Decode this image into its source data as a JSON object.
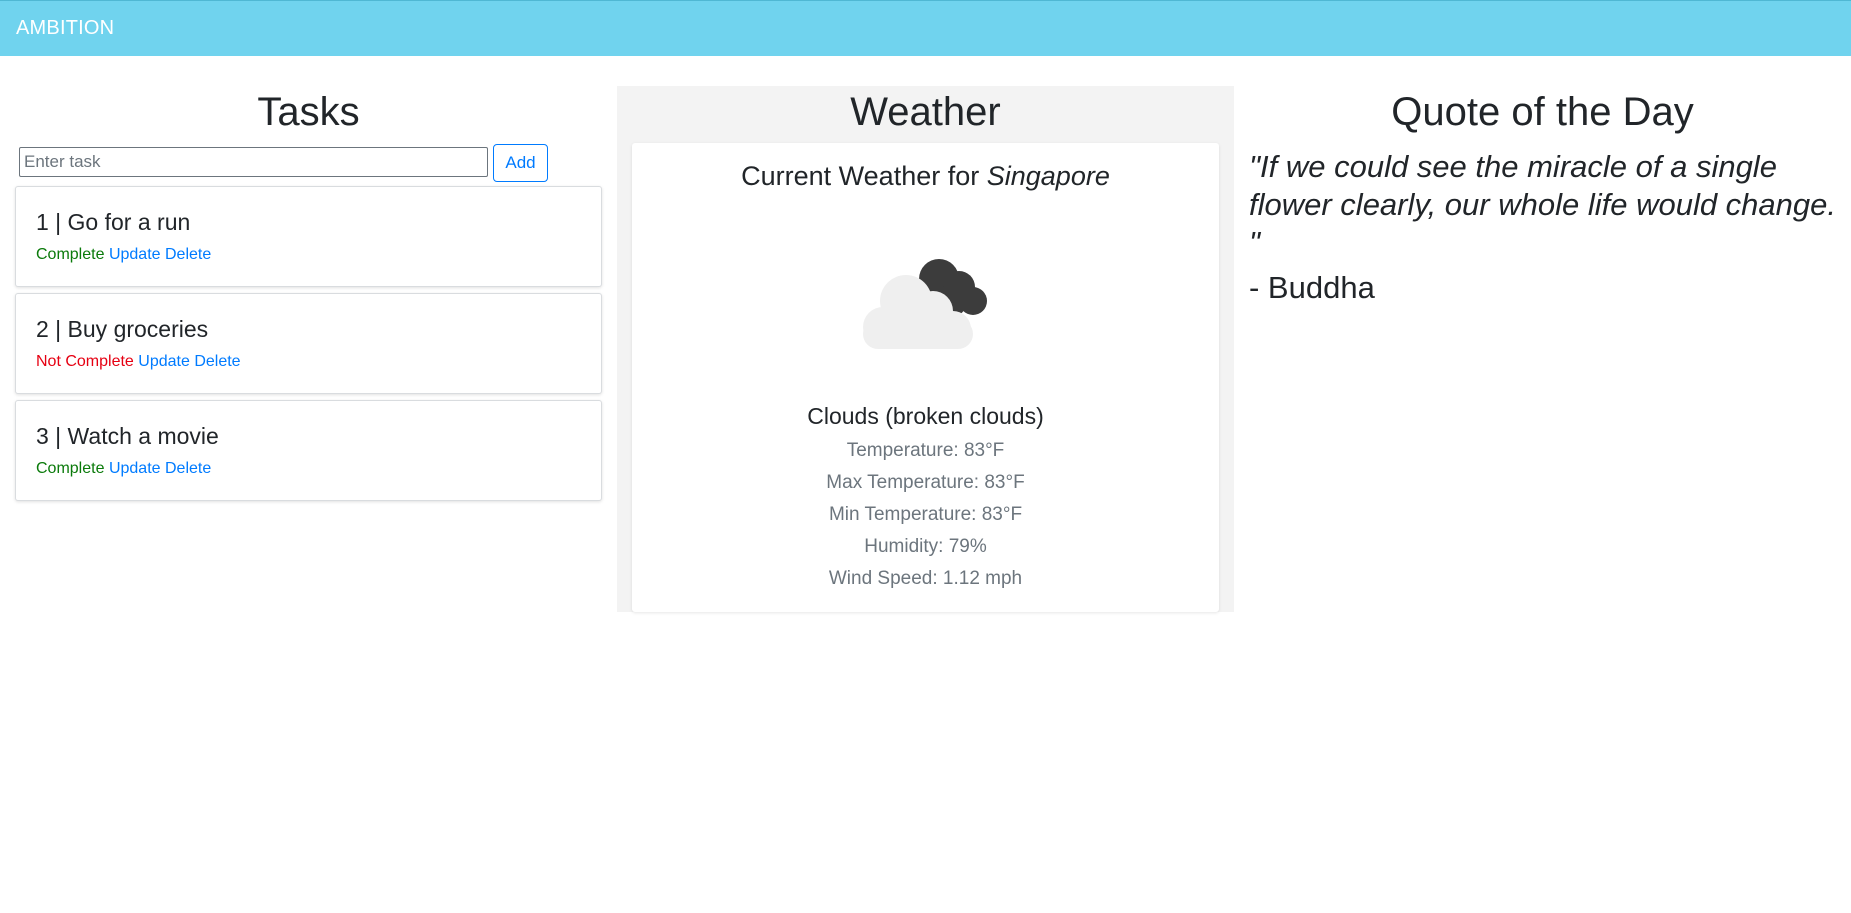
{
  "navbar": {
    "brand": "AMBITION",
    "background_color": "#70d3ee"
  },
  "tasks": {
    "title": "Tasks",
    "input_placeholder": "Enter task",
    "input_value": "",
    "add_label": "Add",
    "items": [
      {
        "title": "1 | Go for a run",
        "status": "Complete",
        "status_color": "#0a7a0a",
        "update_label": "Update",
        "delete_label": "Delete"
      },
      {
        "title": "2 | Buy groceries",
        "status": "Not Complete",
        "status_color": "#e60012",
        "update_label": "Update",
        "delete_label": "Delete"
      },
      {
        "title": "3 | Watch a movie",
        "status": "Complete",
        "status_color": "#0a7a0a",
        "update_label": "Update",
        "delete_label": "Delete"
      }
    ]
  },
  "weather": {
    "title": "Weather",
    "heading_prefix": "Current Weather for ",
    "city": "Singapore",
    "icon": "broken-clouds-icon",
    "description": "Clouds (broken clouds)",
    "temperature": "Temperature: 83°F",
    "max_temperature": "Max Temperature: 83°F",
    "min_temperature": "Min Temperature: 83°F",
    "humidity": "Humidity: 79%",
    "wind_speed": "Wind Speed: 1.12 mph"
  },
  "quote": {
    "title": "Quote of the Day",
    "text": "\"If we could see the miracle of a single flower clearly, our whole life would change. \"",
    "author": "- Buddha"
  },
  "colors": {
    "link": "#007bff",
    "complete": "#0a7a0a",
    "not_complete": "#e60012"
  }
}
